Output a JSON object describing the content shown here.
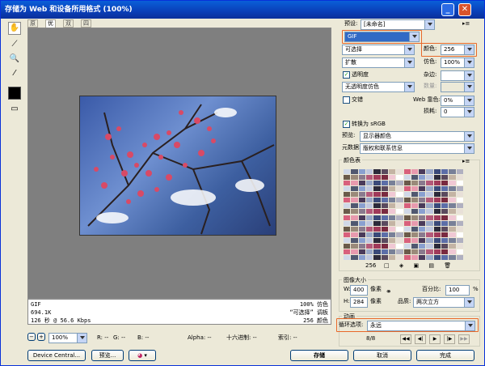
{
  "window": {
    "title": "存储为 Web 和设备所用格式 (100%)",
    "min": "_",
    "close": "✕"
  },
  "tabs": [
    {
      "label": "原稿"
    },
    {
      "label": "优化"
    },
    {
      "label": "双联"
    },
    {
      "label": "四联"
    }
  ],
  "info_left": {
    "format": "GIF",
    "size": "694.1K",
    "time": "126 秒 @ 56.6 Kbps"
  },
  "info_right": {
    "dither": "100% 仿色",
    "palette": "“可选择” 调板",
    "colors": "256 颜色"
  },
  "status": {
    "zoom": "100%",
    "r": "R: --",
    "g": "G: --",
    "b": "B: --",
    "alpha": "Alpha: --",
    "hex": "十六进制: --",
    "index": "索引: --"
  },
  "bottom_buttons": {
    "device_central": "Device Central...",
    "preview": "预览...",
    "save": "存储",
    "cancel": "取消",
    "done": "完成"
  },
  "settings": {
    "preset_label": "预设:",
    "preset_value": "[未命名]",
    "format_value": "GIF",
    "reduction_value": "可选择",
    "colors_label": "颜色:",
    "colors_value": "256",
    "dither_algo_value": "扩散",
    "dither_label": "仿色:",
    "dither_value": "100%",
    "transparency_label": "透明度",
    "matte_label": "杂边:",
    "transparency_dither_value": "无透明度仿色",
    "amount_label": "数量:",
    "interlaced_label": "交错",
    "web_snap_label": "Web 靠色:",
    "web_snap_value": "0%",
    "lossy_label": "损耗:",
    "lossy_value": "0",
    "convert_srgb_label": "转换为 sRGB",
    "preview_label": "预览:",
    "preview_value": "显示器颜色",
    "metadata_label": "元数据:",
    "metadata_value": "版权和联系信息"
  },
  "color_table": {
    "title": "颜色表",
    "count": "256"
  },
  "image_size": {
    "title": "图像大小",
    "w_label": "W:",
    "w_value": "400",
    "w_unit": "像素",
    "h_label": "H:",
    "h_value": "284",
    "h_unit": "像素",
    "percent_label": "百分比:",
    "percent_value": "100",
    "percent_unit": "%",
    "quality_label": "品质:",
    "quality_value": "两次立方"
  },
  "animation": {
    "title": "动画",
    "loop_label": "循环选项:",
    "loop_value": "永远",
    "frame": "8/8"
  },
  "colors": {
    "highlight": "#e8692a",
    "titlebar": "#0a4fd0",
    "canvas_bg": "#7f7f7f"
  }
}
